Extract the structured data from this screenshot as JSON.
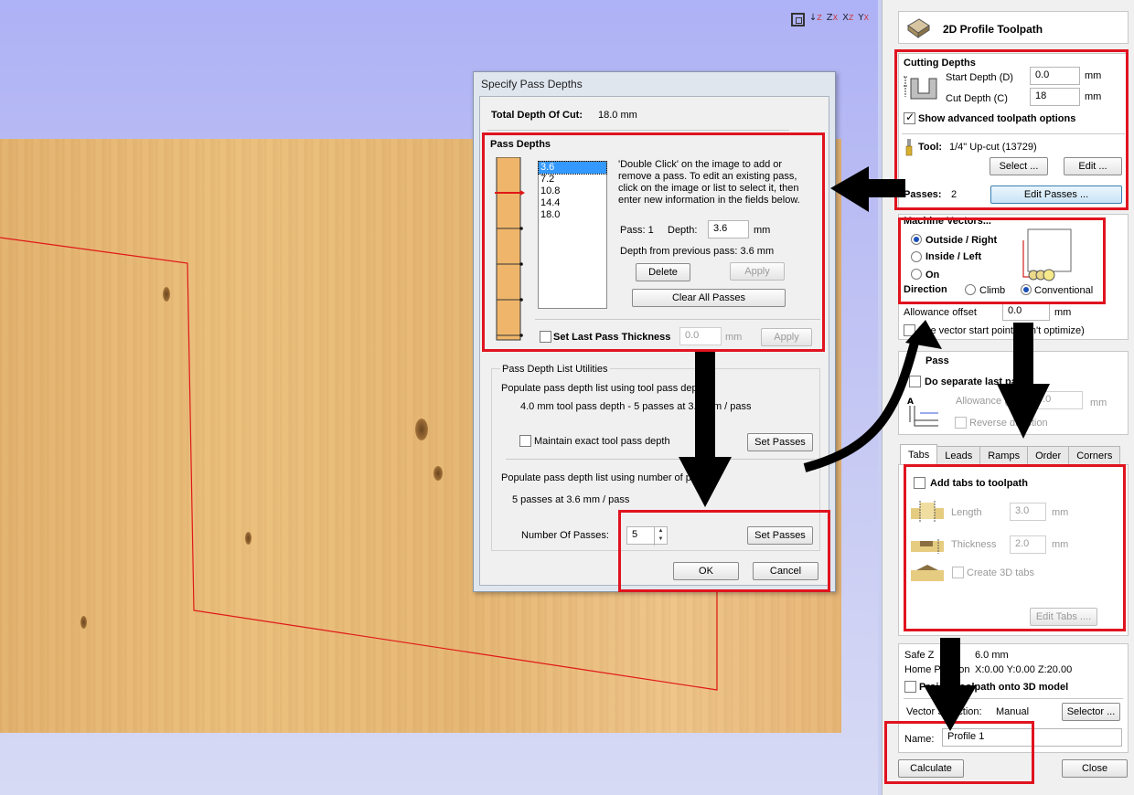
{
  "viewport": {
    "axis_icons": [
      {
        "main": "↓",
        "sub": "Z"
      },
      {
        "main": "Z",
        "sub": "X"
      },
      {
        "main": "X",
        "sub": "Z"
      },
      {
        "main": "Y",
        "sub": "X"
      }
    ]
  },
  "panel": {
    "title": "2D Profile Toolpath",
    "cutting_depths": {
      "heading": "Cutting Depths",
      "start_label": "Start Depth (D)",
      "start_value": "0.0",
      "cut_label": "Cut Depth (C)",
      "cut_value": "18",
      "unit": "mm",
      "show_advanced_label": "Show advanced toolpath options",
      "tool_label": "Tool:",
      "tool_value": "1/4\" Up-cut (13729)",
      "select_btn": "Select ...",
      "edit_btn": "Edit ...",
      "passes_label": "Passes:",
      "passes_value": "2",
      "edit_passes_btn": "Edit Passes ..."
    },
    "machine_vectors": {
      "heading": "Machine Vectors...",
      "outside": "Outside / Right",
      "inside": "Inside / Left",
      "on": "On",
      "direction_label": "Direction",
      "climb": "Climb",
      "conventional": "Conventional",
      "allowance_label": "Allowance offset",
      "allowance_value": "0.0",
      "unit": "mm",
      "vector_start_label": "Use vector start point (don't optimize)"
    },
    "last_pass": {
      "heading": "Pass",
      "separate_label": "Do separate last pass",
      "allowance_label": "Allowance (",
      "allowance_value": "0.0",
      "unit": "mm",
      "reverse_label": "Reverse direction"
    },
    "tabs": [
      "Tabs",
      "Leads",
      "Ramps",
      "Order",
      "Corners"
    ],
    "tabs_page": {
      "add_tabs_label": "Add tabs to toolpath",
      "length_label": "Length",
      "length_value": "3.0",
      "thickness_label": "Thickness",
      "thickness_value": "2.0",
      "unit": "mm",
      "create_3d_label": "Create 3D tabs",
      "edit_tabs_btn": "Edit Tabs ...."
    },
    "footer": {
      "safe_z_label": "Safe Z",
      "safe_z_value": "6.0 mm",
      "home_label": "Home Position",
      "home_value": "X:0.00 Y:0.00 Z:20.00",
      "project_label": "Project toolpath onto 3D model",
      "vector_sel_label": "Vector Selection:",
      "vector_sel_value": "Manual",
      "selector_btn": "Selector ...",
      "name_label": "Name:",
      "name_value": "Profile 1",
      "calculate_btn": "Calculate",
      "close_btn": "Close"
    }
  },
  "dialog": {
    "title": "Specify Pass Depths",
    "total_label": "Total Depth Of Cut:",
    "total_value": "18.0 mm",
    "pass_depths_heading": "Pass Depths",
    "list": [
      "3.6",
      "7.2",
      "10.8",
      "14.4",
      "18.0"
    ],
    "help_text": "'Double Click' on the image to add or remove a pass. To edit an existing pass, click on the image or list to select it, then enter new information in the fields below.",
    "pass_label": "Pass: 1",
    "depth_label": "Depth:",
    "depth_value": "3.6",
    "unit": "mm",
    "from_prev": "Depth from previous pass:  3.6 mm",
    "delete_btn": "Delete",
    "apply_btn": "Apply",
    "clear_btn": "Clear All Passes",
    "last_pass_label": "Set Last Pass Thickness",
    "last_pass_value": "0.0",
    "utilities_heading": "Pass Depth List Utilities",
    "populate_tool_label": "Populate pass depth list using tool pass depth",
    "tool_pass_text": "4.0 mm tool pass depth - 5 passes at 3.6 mm / pass",
    "maintain_label": "Maintain exact tool pass depth",
    "set_passes_btn": "Set Passes",
    "populate_num_label": "Populate pass depth list using number of passes",
    "num_pass_text": "5 passes at 3.6 mm / pass",
    "num_passes_label": "Number Of Passes:",
    "num_passes_value": "5",
    "ok_btn": "OK",
    "cancel_btn": "Cancel"
  }
}
